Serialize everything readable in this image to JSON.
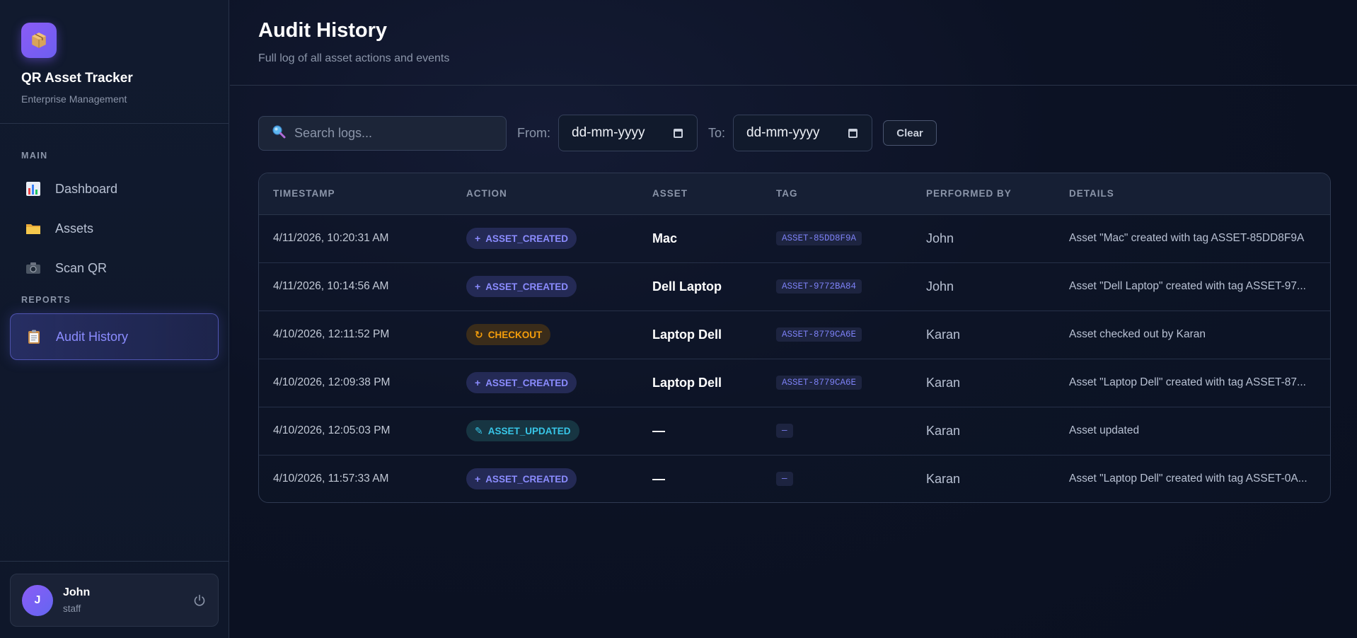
{
  "app": {
    "title": "QR Asset Tracker",
    "subtitle": "Enterprise Management",
    "logo_icon": "package-icon",
    "accent": "#6366f1"
  },
  "sidebar": {
    "sections": [
      {
        "label": "MAIN",
        "items": [
          {
            "label": "Dashboard",
            "icon": "bar-chart-icon",
            "active": false
          },
          {
            "label": "Assets",
            "icon": "folder-icon",
            "active": false
          },
          {
            "label": "Scan QR",
            "icon": "camera-icon",
            "active": false
          }
        ]
      },
      {
        "label": "REPORTS",
        "items": [
          {
            "label": "Audit History",
            "icon": "clipboard-icon",
            "active": true
          }
        ]
      }
    ]
  },
  "user": {
    "initial": "J",
    "name": "John",
    "role": "staff"
  },
  "header": {
    "title": "Audit History",
    "subtitle": "Full log of all asset actions and events"
  },
  "filters": {
    "search_placeholder": "Search logs...",
    "from_label": "From:",
    "from_value": "dd-mm-yyyy",
    "to_label": "To:",
    "to_value": "dd-mm-yyyy",
    "clear_label": "Clear"
  },
  "table": {
    "columns": [
      "TIMESTAMP",
      "ACTION",
      "ASSET",
      "TAG",
      "PERFORMED BY",
      "DETAILS"
    ],
    "rows": [
      {
        "timestamp": "4/11/2026, 10:20:31 AM",
        "action": "ASSET_CREATED",
        "action_type": "created",
        "asset": "Mac",
        "tag": "ASSET-85DD8F9A",
        "user": "John",
        "details": "Asset \"Mac\" created with tag ASSET-85DD8F9A"
      },
      {
        "timestamp": "4/11/2026, 10:14:56 AM",
        "action": "ASSET_CREATED",
        "action_type": "created",
        "asset": "Dell Laptop",
        "tag": "ASSET-9772BA84",
        "user": "John",
        "details": "Asset \"Dell Laptop\" created with tag ASSET-97..."
      },
      {
        "timestamp": "4/10/2026, 12:11:52 PM",
        "action": "CHECKOUT",
        "action_type": "checkout",
        "asset": "Laptop Dell",
        "tag": "ASSET-8779CA6E",
        "user": "Karan",
        "details": "Asset checked out by Karan"
      },
      {
        "timestamp": "4/10/2026, 12:09:38 PM",
        "action": "ASSET_CREATED",
        "action_type": "created",
        "asset": "Laptop Dell",
        "tag": "ASSET-8779CA6E",
        "user": "Karan",
        "details": "Asset \"Laptop Dell\" created with tag ASSET-87..."
      },
      {
        "timestamp": "4/10/2026, 12:05:03 PM",
        "action": "ASSET_UPDATED",
        "action_type": "updated",
        "asset": "—",
        "tag": "—",
        "user": "Karan",
        "details": "Asset updated"
      },
      {
        "timestamp": "4/10/2026, 11:57:33 AM",
        "action": "ASSET_CREATED",
        "action_type": "created",
        "asset": "—",
        "tag": "—",
        "user": "Karan",
        "details": "Asset \"Laptop Dell\" created with tag ASSET-0A..."
      }
    ]
  }
}
